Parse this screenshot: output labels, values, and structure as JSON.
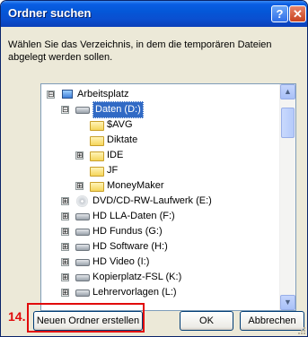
{
  "window": {
    "title": "Ordner suchen",
    "help_label": "?",
    "close_label": "✕"
  },
  "description": "Wählen Sie das Verzeichnis, in dem die temporären Dateien abgelegt werden sollen.",
  "tree": {
    "root": {
      "expander": "⊟",
      "label": "Arbeitsplatz",
      "icon": "computer-icon"
    },
    "items": [
      {
        "label": "Daten (D:)",
        "icon": "drive-icon",
        "expander": "⊟",
        "selected": true
      },
      {
        "label": "$AVG",
        "icon": "folder-icon",
        "expander": ""
      },
      {
        "label": "Diktate",
        "icon": "folder-icon",
        "expander": ""
      },
      {
        "label": "IDE",
        "icon": "folder-icon",
        "expander": "⊞"
      },
      {
        "label": "JF",
        "icon": "folder-icon",
        "expander": ""
      },
      {
        "label": "MoneyMaker",
        "icon": "folder-icon",
        "expander": "⊞"
      },
      {
        "label": "DVD/CD-RW-Laufwerk (E:)",
        "icon": "cd-drive-icon",
        "expander": "⊞"
      },
      {
        "label": "HD LLA-Daten (F:)",
        "icon": "network-drive-icon",
        "expander": "⊞"
      },
      {
        "label": "HD Fundus (G:)",
        "icon": "network-drive-icon",
        "expander": "⊞"
      },
      {
        "label": "HD Software (H:)",
        "icon": "network-drive-icon",
        "expander": "⊞"
      },
      {
        "label": "HD Video (I:)",
        "icon": "network-drive-icon",
        "expander": "⊞"
      },
      {
        "label": "Kopierplatz-FSL (K:)",
        "icon": "network-drive-icon",
        "expander": "⊞"
      },
      {
        "label": "Lehrervorlagen (L:)",
        "icon": "network-drive-icon",
        "expander": "⊞"
      }
    ]
  },
  "buttons": {
    "new_folder": "Neuen Ordner erstellen",
    "ok": "OK",
    "cancel": "Abbrechen"
  },
  "annotation": {
    "step": "14."
  },
  "scrollbar": {
    "up": "▲",
    "down": "▼"
  }
}
